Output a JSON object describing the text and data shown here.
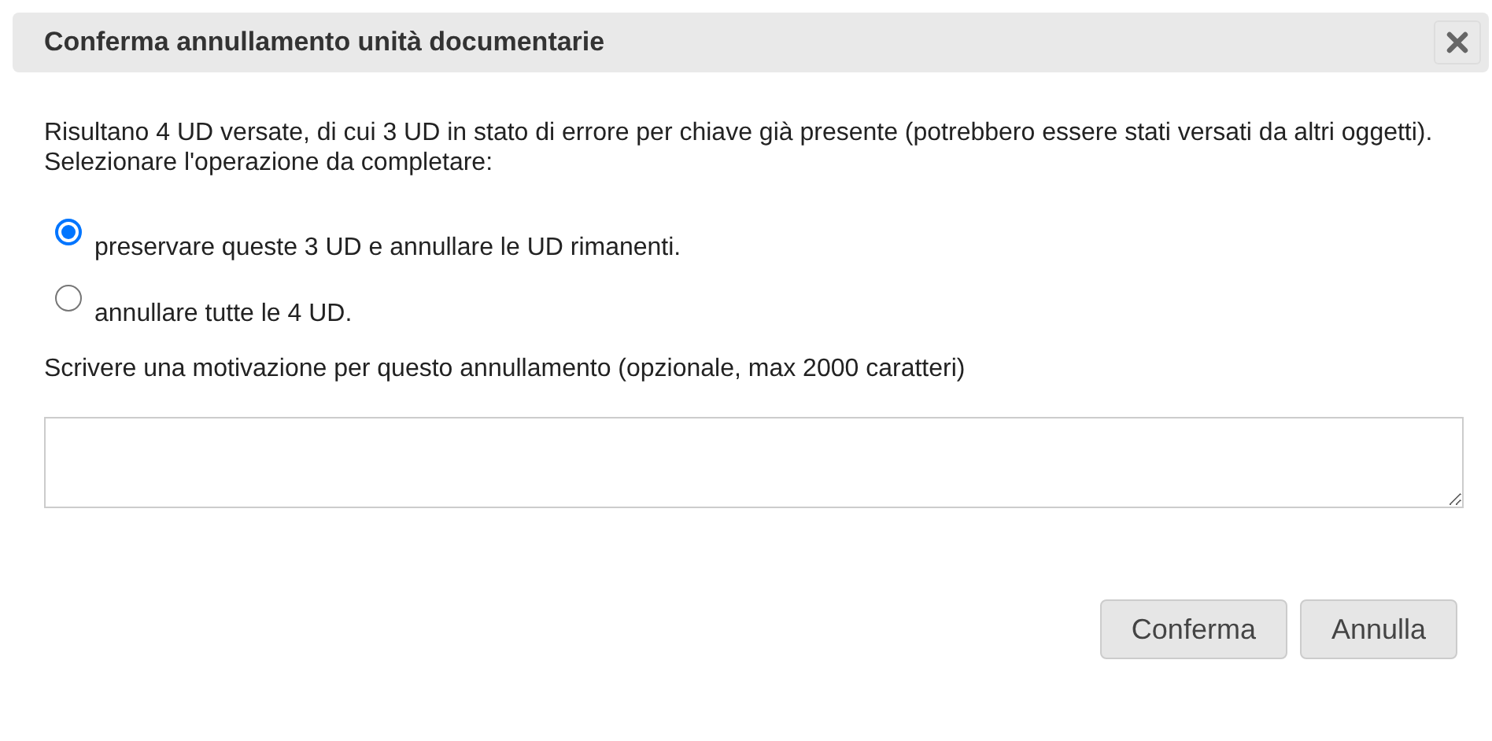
{
  "dialog": {
    "title": "Conferma annullamento unità documentarie"
  },
  "message": [
    "Risultano 4 UD versate, di cui 3 UD in stato di errore per chiave già presente (potrebbero essere stati versati da altri oggetti).",
    "Selezionare l'operazione da completare:"
  ],
  "options": [
    {
      "label": "preservare queste 3 UD e annullare le UD rimanenti.",
      "selected": true
    },
    {
      "label": "annullare tutte le 4 UD.",
      "selected": false
    }
  ],
  "motivation": {
    "label": "Scrivere una motivazione per questo annullamento (opzionale, max 2000 caratteri)"
  },
  "buttons": [
    "Conferma",
    "Annulla"
  ]
}
